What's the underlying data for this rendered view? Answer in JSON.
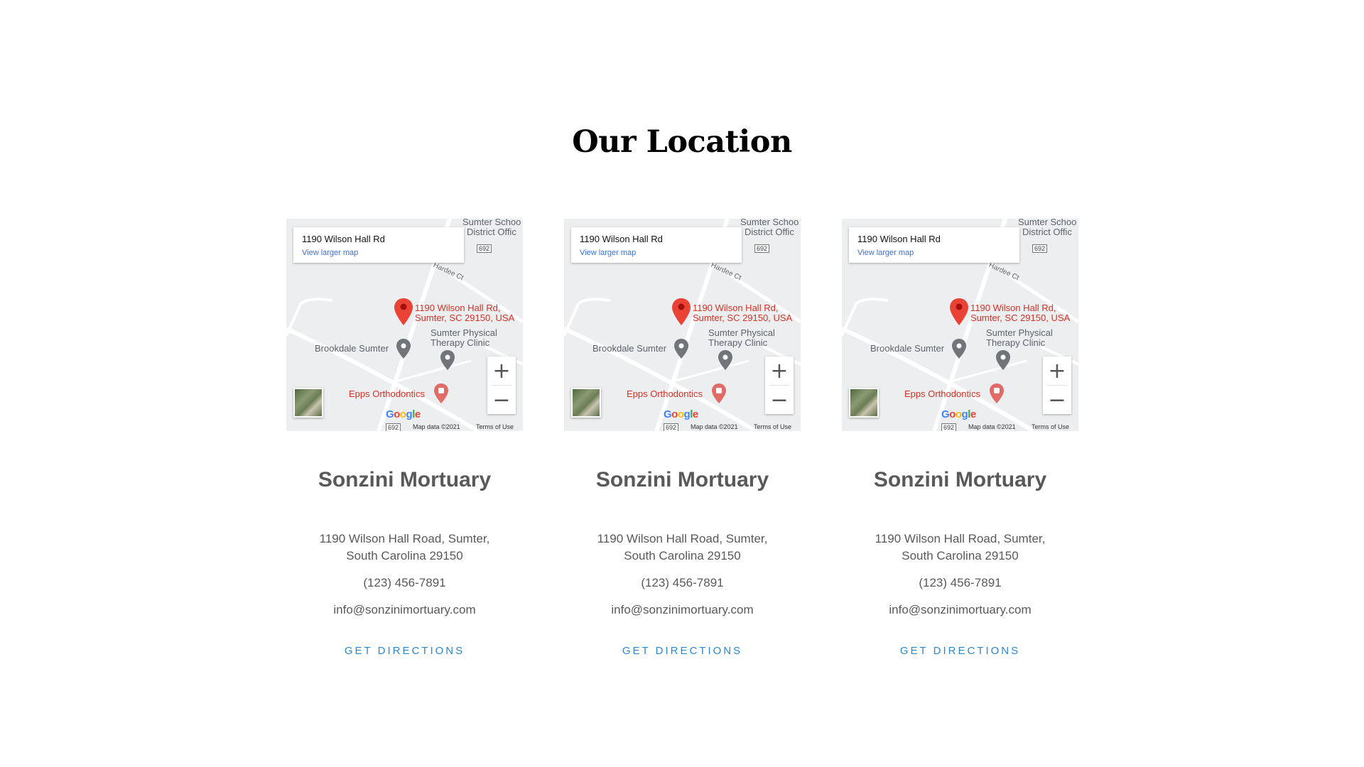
{
  "section": {
    "title": "Our Location"
  },
  "locations": [
    {
      "map": {
        "info_title": "1190 Wilson Hall Rd",
        "info_link": "View larger map",
        "pin_label_1": "1190 Wilson Hall Rd,",
        "pin_label_2": "Sumter, SC 29150, USA",
        "poi_1": "Brookdale Sumter",
        "poi_2_line1": "Sumter Physical",
        "poi_2_line2": "Therapy Clinic",
        "poi_3": "Epps Orthodontics",
        "top_label_1": "Sumter Schoo",
        "top_label_2": "District Offic",
        "road_hardee": "Hardee Ct",
        "route_number": "692",
        "zoom_in": "+",
        "zoom_out": "−",
        "logo": "Google",
        "map_data": "Map data ©2021",
        "terms": "Terms of Use"
      },
      "name": "Sonzini Mortuary",
      "address_line1": "1190 Wilson Hall Road, Sumter,",
      "address_line2": "South Carolina 29150",
      "phone": "(123) 456-7891",
      "email": "info@sonzinimortuary.com",
      "directions": "GET DIRECTIONS"
    },
    {
      "map": {
        "info_title": "1190 Wilson Hall Rd",
        "info_link": "View larger map",
        "pin_label_1": "1190 Wilson Hall Rd,",
        "pin_label_2": "Sumter, SC 29150, USA",
        "poi_1": "Brookdale Sumter",
        "poi_2_line1": "Sumter Physical",
        "poi_2_line2": "Therapy Clinic",
        "poi_3": "Epps Orthodontics",
        "top_label_1": "Sumter Schoo",
        "top_label_2": "District Offic",
        "road_hardee": "Hardee Ct",
        "route_number": "692",
        "zoom_in": "+",
        "zoom_out": "−",
        "logo": "Google",
        "map_data": "Map data ©2021",
        "terms": "Terms of Use"
      },
      "name": "Sonzini Mortuary",
      "address_line1": "1190 Wilson Hall Road, Sumter,",
      "address_line2": "South Carolina 29150",
      "phone": "(123) 456-7891",
      "email": "info@sonzinimortuary.com",
      "directions": "GET DIRECTIONS"
    },
    {
      "map": {
        "info_title": "1190 Wilson Hall Rd",
        "info_link": "View larger map",
        "pin_label_1": "1190 Wilson Hall Rd,",
        "pin_label_2": "Sumter, SC 29150, USA",
        "poi_1": "Brookdale Sumter",
        "poi_2_line1": "Sumter Physical",
        "poi_2_line2": "Therapy Clinic",
        "poi_3": "Epps Orthodontics",
        "top_label_1": "Sumter Schoo",
        "top_label_2": "District Offic",
        "road_hardee": "Hardee Ct",
        "route_number": "692",
        "zoom_in": "+",
        "zoom_out": "−",
        "logo": "Google",
        "map_data": "Map data ©2021",
        "terms": "Terms of Use"
      },
      "name": "Sonzini Mortuary",
      "address_line1": "1190 Wilson Hall Road, Sumter,",
      "address_line2": "South Carolina 29150",
      "phone": "(123) 456-7891",
      "email": "info@sonzinimortuary.com",
      "directions": "GET DIRECTIONS"
    }
  ],
  "colors": {
    "accent_link": "#2b87d1",
    "text": "#595959",
    "map_pin": "#ea4335",
    "map_poi": "#70757a"
  }
}
